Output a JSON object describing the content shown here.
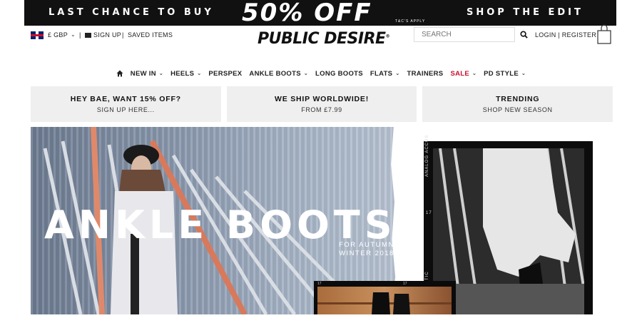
{
  "promo_banner": {
    "left_text": "LAST CHANCE TO BUY",
    "center_text": "50% OFF",
    "right_text": "SHOP THE EDIT",
    "fine_print": "T&C'S APPLY"
  },
  "header": {
    "currency": "£ GBP",
    "sign_up": "SIGN UP",
    "separator": "|",
    "saved_items": "SAVED ITEMS",
    "logo": "PUBLIC DESIRE",
    "logo_mark": "®",
    "search_placeholder": "SEARCH",
    "login_register": "LOGIN | REGISTER"
  },
  "nav": [
    {
      "label": "NEW IN",
      "has_dropdown": true
    },
    {
      "label": "HEELS",
      "has_dropdown": true
    },
    {
      "label": "PERSPEX",
      "has_dropdown": false
    },
    {
      "label": "ANKLE BOOTS",
      "has_dropdown": true
    },
    {
      "label": "LONG BOOTS",
      "has_dropdown": false
    },
    {
      "label": "FLATS",
      "has_dropdown": true
    },
    {
      "label": "TRAINERS",
      "has_dropdown": false
    },
    {
      "label": "SALE",
      "has_dropdown": true
    },
    {
      "label": "PD STYLE",
      "has_dropdown": true
    }
  ],
  "promo_boxes": [
    {
      "title": "HEY BAE, WANT 15% OFF?",
      "subtitle": "SIGN UP HERE..."
    },
    {
      "title": "WE SHIP WORLDWIDE!",
      "subtitle": "FROM £7.99"
    },
    {
      "title": "TRENDING",
      "subtitle": "SHOP NEW SEASON"
    }
  ],
  "hero": {
    "title": "ANKLE BOOTS",
    "subtitle_line1": "FOR AUTUMN",
    "subtitle_line2": "WINTER 2018"
  },
  "side_photo": {
    "edge_text_top": "ANALOG ACCUS",
    "edge_text_num": "17",
    "edge_text_bottom": "STIC"
  },
  "bottom_photo": {
    "frame_num_left": "17",
    "frame_num_right": "17"
  },
  "colors": {
    "sale": "#c8102e",
    "promo_bg": "#111111",
    "box_bg": "#efefef"
  }
}
